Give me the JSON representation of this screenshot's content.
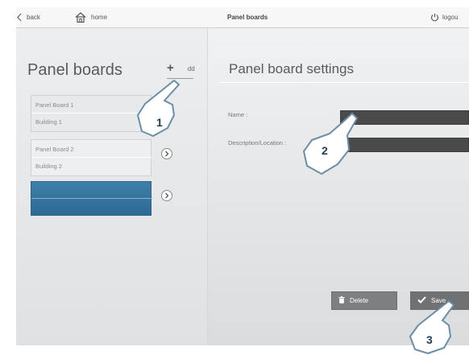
{
  "topbar": {
    "back_label": "back",
    "home_label": "home",
    "title": "Panel boards",
    "logout_label": "logou"
  },
  "left": {
    "title": "Panel boards",
    "add_label": "dd",
    "cards": [
      {
        "name": "Panel Board 1",
        "location": "Building 1"
      },
      {
        "name": "Panel Board 2",
        "location": "Building 2"
      },
      {
        "name": "",
        "location": ""
      }
    ]
  },
  "right": {
    "title": "Panel board settings",
    "name_label": "Name :",
    "desc_label": "Description/Location :",
    "name_value": "",
    "desc_value": "",
    "delete_label": "Delete",
    "save_label": "Save"
  },
  "callouts": [
    "1",
    "2",
    "3"
  ],
  "colors": {
    "accent": "#2e6a93",
    "field": "#4a4a4a",
    "button": "#7d7f81"
  }
}
